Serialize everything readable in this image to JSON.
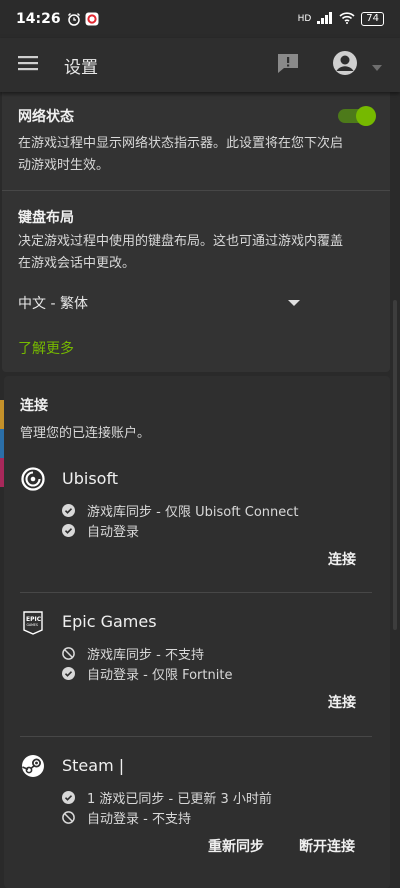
{
  "status_bar": {
    "time": "14:26",
    "battery": "74",
    "net_label": "HD"
  },
  "app_bar": {
    "title": "设置"
  },
  "network_status": {
    "title": "网络状态",
    "desc_line1": "在游戏过程中显示网络状态指示器。此设置将在您下次启",
    "desc_line2": "动游戏时生效。",
    "enabled": true
  },
  "keyboard_layout": {
    "title": "键盘布局",
    "desc_line1": "决定游戏过程中使用的键盘布局。这也可通过游戏内覆盖",
    "desc_line2": "在游戏会话中更改。",
    "selected": "中文 - 繁体",
    "learn_more": "了解更多"
  },
  "connections": {
    "title": "连接",
    "desc": "管理您的已连接账户。",
    "accounts": [
      {
        "name": "Ubisoft",
        "icon": "ubisoft-icon",
        "features": [
          {
            "text": "游戏库同步 - 仅限 Ubisoft Connect",
            "status": "check"
          },
          {
            "text": "自动登录",
            "status": "check"
          }
        ],
        "actions": [
          "连接"
        ]
      },
      {
        "name": "Epic Games",
        "icon": "epic-games-icon",
        "features": [
          {
            "text": "游戏库同步 - 不支持",
            "status": "blocked"
          },
          {
            "text": "自动登录 - 仅限 Fortnite",
            "status": "check"
          }
        ],
        "actions": [
          "连接"
        ]
      },
      {
        "name": "Steam |",
        "icon": "steam-icon",
        "features": [
          {
            "text": "1 游戏已同步 - 已更新 3 小时前",
            "status": "check"
          },
          {
            "text": "自动登录 - 不支持",
            "status": "blocked"
          }
        ],
        "actions": [
          "重新同步",
          "断开连接"
        ]
      }
    ]
  },
  "colors": {
    "accent": "#76b900",
    "background": "#2a2a2a",
    "card": "#333333"
  }
}
